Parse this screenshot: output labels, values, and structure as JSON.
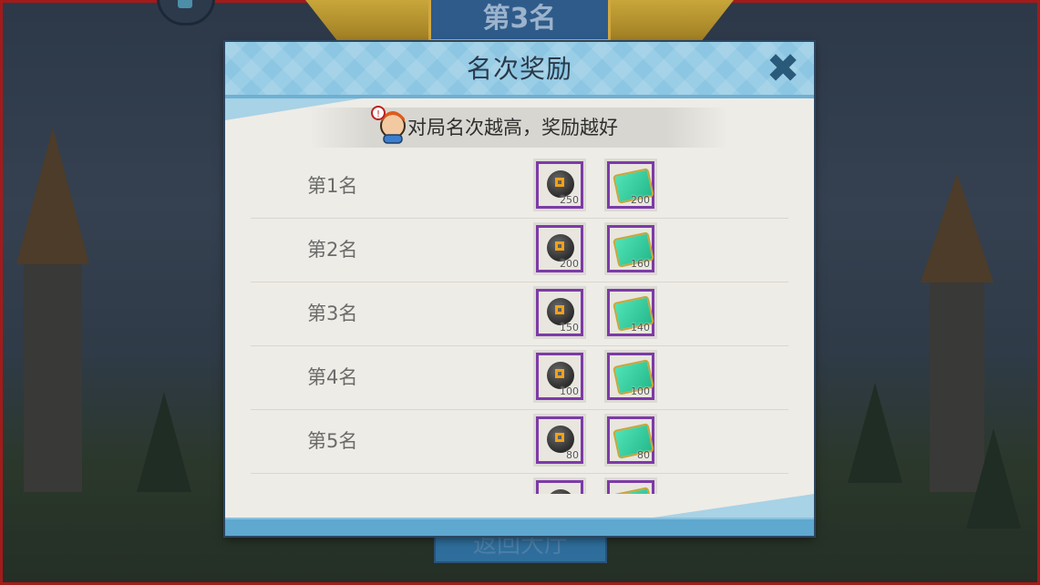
{
  "background": {
    "top_rank_label": "第3名",
    "back_button_label": "返回大厅"
  },
  "dialog": {
    "title": "名次奖励",
    "close_icon": "close-icon",
    "subtitle": "对局名次越高，奖励越好",
    "rewards": [
      {
        "rank": "第1名",
        "coin_qty": "250",
        "book_qty": "200"
      },
      {
        "rank": "第2名",
        "coin_qty": "200",
        "book_qty": "160"
      },
      {
        "rank": "第3名",
        "coin_qty": "150",
        "book_qty": "140"
      },
      {
        "rank": "第4名",
        "coin_qty": "100",
        "book_qty": "100"
      },
      {
        "rank": "第5名",
        "coin_qty": "80",
        "book_qty": "80"
      },
      {
        "rank": "",
        "coin_qty": "",
        "book_qty": ""
      }
    ]
  },
  "colors": {
    "header_blue": "#8cc6e2",
    "reward_border": "#7d3aa8",
    "panel_bg": "#eeece6"
  }
}
